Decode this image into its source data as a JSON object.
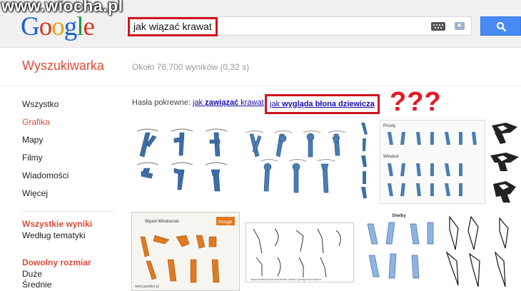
{
  "watermark": "www.wiocha.pl",
  "logo": {
    "letters": [
      "G",
      "o",
      "o",
      "g",
      "l",
      "e"
    ],
    "colors": [
      "#1a5fd0",
      "#d5381f",
      "#e9a416",
      "#1a5fd0",
      "#189b40",
      "#d5381f"
    ]
  },
  "search": {
    "query": "jak wiązać krawat"
  },
  "header": {
    "title": "Wyszukiwarka",
    "stats": "Około 76,700 wyników (0,32 s)"
  },
  "sidebar": {
    "items": [
      {
        "label": "Wszystko"
      },
      {
        "label": "Grafika"
      },
      {
        "label": "Mapy"
      },
      {
        "label": "Filmy"
      },
      {
        "label": "Wiadomości"
      },
      {
        "label": "Więcej"
      }
    ],
    "all_results_heading": "Wszystkie wyniki",
    "by_topic": "Według tematyki",
    "size_heading": "Dowolny rozmiar",
    "size_large": "Duże",
    "size_medium": "Średnie"
  },
  "related": {
    "label": "Hasła pokrewne:",
    "link1_pre": "jak ",
    "link1_bold": "zawiązać",
    "link1_post": " krawat",
    "link2_pre": "jak ",
    "link2_bold": "wygląda błona dziewicza"
  },
  "annotation": {
    "marks": "???"
  },
  "thumbnails": {
    "t4_label1": "Prosty",
    "t4_label2": "Windsor",
    "t6_title": "Węzeł Windsorski",
    "t6_logo": "Google",
    "t6_footer": "www.jawisko.pl",
    "t8_title": "Shelby",
    "t7_caption": "Węzeł windsorski jest stosunkowo szeroki i wymaga dużo miejsca."
  },
  "colors": {
    "accent_red": "#dd4b39",
    "link": "#1a0dab",
    "search_blue": "#4a8af4",
    "highlight_red": "#d0141d",
    "tie_blue": "#3c6ea8"
  }
}
